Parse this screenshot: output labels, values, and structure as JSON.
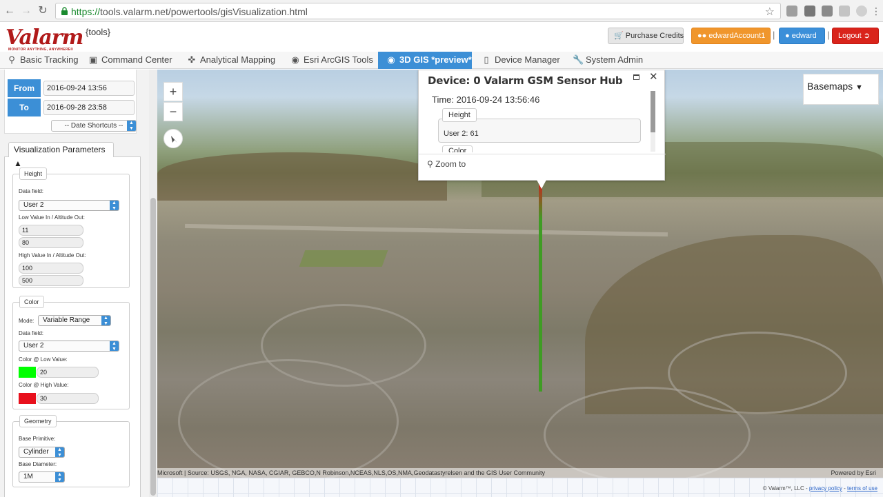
{
  "browser": {
    "url_protocol": "https://",
    "url_rest": "tools.valarm.net/powertools/gisVisualization.html",
    "back_icon": "back-arrow-icon",
    "forward_icon": "forward-arrow-icon",
    "reload_icon": "reload-icon",
    "bookmark_icon": "star-icon"
  },
  "header": {
    "logo": "Valarm",
    "logo_tagline": "MONITOR ANYTHING, ANYWHERE®",
    "logo_suffix": "{tools}",
    "purchase_label": "Purchase Credits",
    "account_label": "edwardAccount1",
    "user_label": "edward",
    "logout_label": "Logout",
    "separator": "|"
  },
  "tabs": [
    {
      "label": "Basic Tracking",
      "icon": "map-marker-icon"
    },
    {
      "label": "Command Center",
      "icon": "monitor-icon"
    },
    {
      "label": "Analytical Mapping",
      "icon": "crosshair-icon"
    },
    {
      "label": "Esri ArcGIS Tools",
      "icon": "globe-icon"
    },
    {
      "label": "3D GIS *preview*",
      "icon": "globe-icon",
      "active": true
    },
    {
      "label": "Device Manager",
      "icon": "phone-icon"
    },
    {
      "label": "System Admin",
      "icon": "wrench-icon"
    }
  ],
  "date_range": {
    "from_label": "From",
    "from_value": "2016-09-24 13:56",
    "to_label": "To",
    "to_value": "2016-09-28 23:58",
    "shortcuts": "-- Date Shortcuts --"
  },
  "viz": {
    "header": "Visualization Parameters",
    "height": {
      "legend": "Height",
      "data_field_label": "Data field:",
      "data_field_value": "User 2",
      "low_label": "Low Value In / Altitude Out:",
      "low_in": "11",
      "low_out": "80",
      "high_label": "High Value In / Altitude Out:",
      "high_in": "100",
      "high_out": "500"
    },
    "color": {
      "legend": "Color",
      "mode_label": "Mode:",
      "mode_value": "Variable Range",
      "data_field_label": "Data field:",
      "data_field_value": "User 2",
      "low_label": "Color @ Low Value:",
      "low_value": "20",
      "low_color": "#00ff00",
      "high_label": "Color @ High Value:",
      "high_value": "30",
      "high_color": "#e8101c"
    },
    "geometry": {
      "legend": "Geometry",
      "primitive_label": "Base Primitive:",
      "primitive_value": "Cylinder",
      "diameter_label": "Base Diameter:",
      "diameter_value": "1M"
    }
  },
  "map": {
    "zoom_in": "+",
    "zoom_out": "−",
    "basemaps": "Basemaps",
    "attribution": "Microsoft | Source: USGS, NGA, NASA, CGIAR, GEBCO,N Robinson,NCEAS,NLS,OS,NMA,Geodatastyrelsen and the GIS User Community",
    "powered_by": "Powered by Esri",
    "popup": {
      "title": "Device: 0 Valarm GSM Sensor Hub",
      "time": "Time: 2016-09-24 13:56:46",
      "height_legend": "Height",
      "height_value": "User 2: 61",
      "color_legend": "Color",
      "zoom_to": "Zoom to",
      "close": "✕"
    }
  },
  "footer": {
    "copyright": "© Valarm™, LLC - ",
    "privacy": "privacy policy",
    "dash": " - ",
    "terms": "terms of use"
  },
  "colors": {
    "accent": "#3c8fd6",
    "logout": "#d9241b",
    "account": "#f0962c",
    "column_green": "#3f9c24",
    "column_red": "#c82620"
  }
}
